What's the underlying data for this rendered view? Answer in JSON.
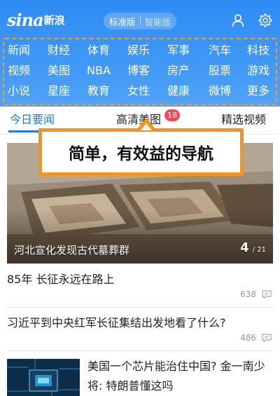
{
  "header": {
    "logo_text": "sina",
    "logo_cn": "新浪",
    "version_active": "标准版",
    "version_inactive": "智能版"
  },
  "channels": [
    [
      "新闻",
      "财经",
      "体育",
      "娱乐",
      "军事",
      "汽车",
      "科技"
    ],
    [
      "视频",
      "美图",
      "NBA",
      "博客",
      "房产",
      "股票",
      "游戏"
    ],
    [
      "小说",
      "星座",
      "教育",
      "女性",
      "健康",
      "微博",
      "更多"
    ]
  ],
  "tabs": {
    "today": "今日要闻",
    "hd_pics": "高清美图",
    "hd_badge": "18",
    "videos": "精选视频"
  },
  "callout": {
    "text": "简单，有效益的导航"
  },
  "hero": {
    "caption": "河北宣化发现古代墓葬群",
    "current": "4",
    "total": "/ 21"
  },
  "articles": [
    {
      "title": "85年 长征永远在路上",
      "comments": "638"
    },
    {
      "title": "习近平到中央红军长征集结出发地看了什么?",
      "comments": "486"
    },
    {
      "title": "美国一个芯片能治住中国? 金一南少将: 特朗普懂这吗",
      "comments": ""
    }
  ],
  "colors": {
    "header_blue": "#3f97f5",
    "accent_blue": "#1a7de6",
    "callout_orange": "#f4941c",
    "badge_red": "#f24957"
  }
}
